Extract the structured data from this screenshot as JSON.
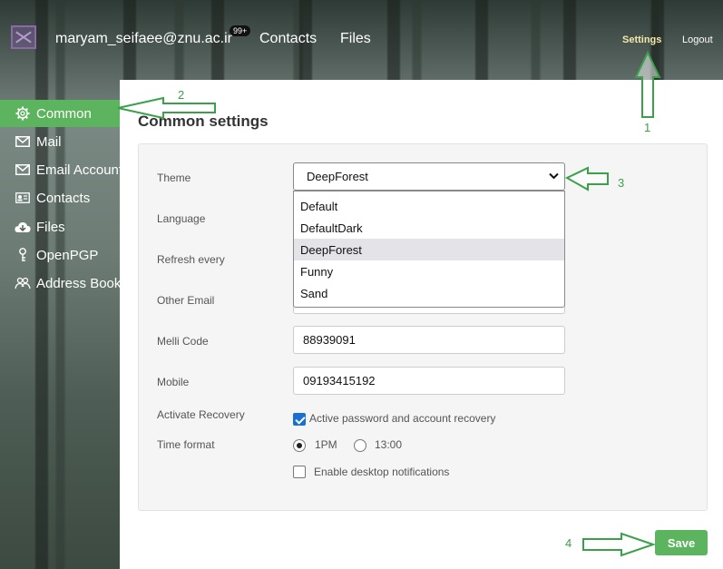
{
  "header": {
    "user_email": "maryam_seifaee@znu.ac.ir",
    "notification_count": "99+",
    "nav": [
      "Contacts",
      "Files"
    ],
    "settings_label": "Settings",
    "logout_label": "Logout"
  },
  "sidebar": {
    "items": [
      {
        "label": "Common",
        "icon": "gear-icon",
        "active": true
      },
      {
        "label": "Mail",
        "icon": "envelope-icon"
      },
      {
        "label": "Email Accounts",
        "icon": "envelope-icon"
      },
      {
        "label": "Contacts",
        "icon": "contact-card-icon"
      },
      {
        "label": "Files",
        "icon": "cloud-download-icon"
      },
      {
        "label": "OpenPGP",
        "icon": "key-icon"
      },
      {
        "label": "Address Book",
        "icon": "people-icon"
      }
    ]
  },
  "main": {
    "title": "Common settings",
    "theme": {
      "label": "Theme",
      "selected": "DeepForest",
      "options": [
        "Default",
        "DefaultDark",
        "DeepForest",
        "Funny",
        "Sand"
      ]
    },
    "language": {
      "label": "Language"
    },
    "refresh": {
      "label": "Refresh every"
    },
    "other_email": {
      "label": "Other Email"
    },
    "melli_code": {
      "label": "Melli Code",
      "value": "88939091"
    },
    "mobile": {
      "label": "Mobile",
      "value": "09193415192"
    },
    "recovery": {
      "label": "Activate Recovery",
      "checkbox_label": "Active password and account recovery",
      "checked": true
    },
    "time_format": {
      "label": "Time format",
      "options": [
        "1PM",
        "13:00"
      ],
      "selected": "1PM"
    },
    "notifications": {
      "label": "Enable desktop notifications",
      "checked": false
    },
    "save_label": "Save"
  },
  "annotations": {
    "numbers": [
      "1",
      "2",
      "3",
      "4"
    ],
    "color": "#3aa04a"
  },
  "colors": {
    "accent": "#5db45e",
    "settings_link": "#f5e9a8",
    "checkbox": "#1a6fd3"
  }
}
